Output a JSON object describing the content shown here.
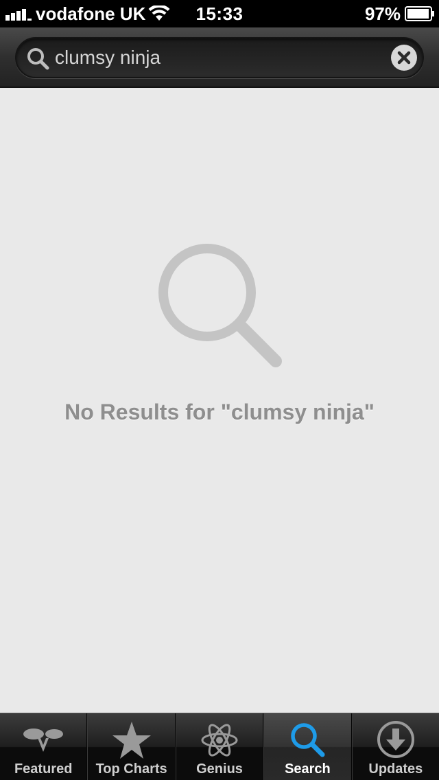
{
  "status_bar": {
    "carrier": "vodafone UK",
    "time": "15:33",
    "battery_percent": "97%",
    "battery_level": 0.97,
    "signal_bars": 4,
    "icons": [
      "signal-icon",
      "wifi-icon",
      "battery-icon"
    ]
  },
  "search": {
    "query": "clumsy ninja",
    "icon": "magnifier-icon",
    "clear_icon": "clear-icon"
  },
  "results": {
    "empty_message": "No Results for \"clumsy ninja\"",
    "icon": "magnifier-icon"
  },
  "tabs": [
    {
      "label": "Featured",
      "icon": "featured-icon",
      "active": false
    },
    {
      "label": "Top Charts",
      "icon": "star-icon",
      "active": false
    },
    {
      "label": "Genius",
      "icon": "atom-icon",
      "active": false
    },
    {
      "label": "Search",
      "icon": "magnifier-icon",
      "active": true
    },
    {
      "label": "Updates",
      "icon": "download-arrow-icon",
      "active": false
    }
  ],
  "colors": {
    "active_tab_icon": "#1e9be8",
    "inactive_tab_icon": "#9a9a9a",
    "content_background": "#e9e9e9",
    "empty_text": "#8e8e8e"
  }
}
